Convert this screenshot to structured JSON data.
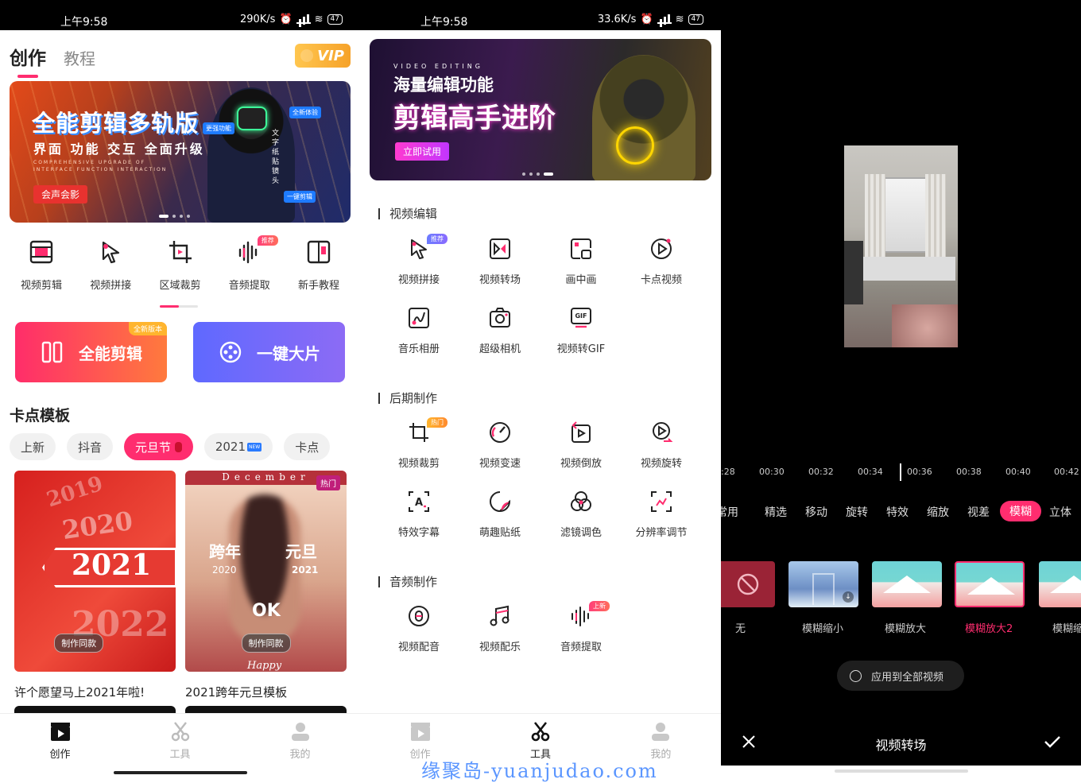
{
  "phone1": {
    "status": {
      "time": "上午9:58",
      "speed": "290K/s",
      "battery": "47"
    },
    "tabs": {
      "active": "创作",
      "other": "教程"
    },
    "vip": "VIP",
    "banner": {
      "headline": "全能剪辑多轨版",
      "sub": "界面 功能 交互 全面升级",
      "tiny": "COMPREHENSIVE UPGRADE OF INTERFACE FUNCTION INTERACTION",
      "button": "会声会影",
      "tag1": "全新体验",
      "tag2": "更强功能",
      "tag3": "一键剪辑",
      "side_text": "文字纸贴镜头"
    },
    "quick": [
      {
        "label": "视频剪辑",
        "icon": "film-icon"
      },
      {
        "label": "视频拼接",
        "icon": "play-cursor-icon"
      },
      {
        "label": "区域裁剪",
        "icon": "crop-icon"
      },
      {
        "label": "音频提取",
        "icon": "audio-wave-icon",
        "badge": "推荐"
      },
      {
        "label": "新手教程",
        "icon": "book-icon"
      }
    ],
    "big_buttons": [
      {
        "label": "全能剪辑",
        "badge": "全新版本"
      },
      {
        "label": "一键大片"
      }
    ],
    "section_title": "卡点模板",
    "chips": [
      "上新",
      "抖音",
      "元旦节",
      "2021",
      "卡点"
    ],
    "chip_new_tag": "NEW",
    "active_chip": "元旦节",
    "cards": [
      {
        "title": "许个愿望马上2021年啦!",
        "button": "制作同款",
        "years": [
          "2019",
          "2020",
          "2021",
          "2022"
        ]
      },
      {
        "title": "2021跨年元旦模板",
        "button": "制作同款",
        "hot": "热门",
        "header": "December",
        "left_big": "跨年",
        "left_year": "2020",
        "right_big": "元旦",
        "right_year": "2021",
        "ok": "OK",
        "footer": "Happy"
      }
    ],
    "tabbar": [
      {
        "label": "创作",
        "active": true
      },
      {
        "label": "工具",
        "active": false
      },
      {
        "label": "我的",
        "active": false
      }
    ]
  },
  "phone2": {
    "status": {
      "time": "上午9:58",
      "speed": "33.6K/s",
      "battery": "47"
    },
    "banner": {
      "ve": "VIDEO EDITING",
      "h1": "海量编辑功能",
      "h2": "剪辑高手进阶",
      "button": "立即试用"
    },
    "groups": [
      {
        "title": "视频编辑",
        "items": [
          {
            "label": "视频拼接",
            "icon": "play-cursor-icon",
            "badge": "推荐"
          },
          {
            "label": "视频转场",
            "icon": "transition-icon"
          },
          {
            "label": "画中画",
            "icon": "pip-icon"
          },
          {
            "label": "卡点视频",
            "icon": "beat-play-icon"
          },
          {
            "label": "音乐相册",
            "icon": "music-album-icon"
          },
          {
            "label": "超级相机",
            "icon": "camera-icon"
          },
          {
            "label": "视频转GIF",
            "icon": "gif-icon"
          }
        ]
      },
      {
        "title": "后期制作",
        "items": [
          {
            "label": "视频裁剪",
            "icon": "crop-icon",
            "badge": "热门"
          },
          {
            "label": "视频变速",
            "icon": "speed-icon"
          },
          {
            "label": "视频倒放",
            "icon": "reverse-icon"
          },
          {
            "label": "视频旋转",
            "icon": "rotate-icon"
          },
          {
            "label": "特效字幕",
            "icon": "subtitle-icon"
          },
          {
            "label": "萌趣贴纸",
            "icon": "sticker-icon"
          },
          {
            "label": "滤镜调色",
            "icon": "filter-icon"
          },
          {
            "label": "分辨率调节",
            "icon": "resolution-icon"
          }
        ]
      },
      {
        "title": "音频制作",
        "items": [
          {
            "label": "视频配音",
            "icon": "voiceover-icon"
          },
          {
            "label": "视频配乐",
            "icon": "music-note-icon"
          },
          {
            "label": "音频提取",
            "icon": "audio-wave-icon",
            "badge": "上新"
          }
        ]
      }
    ],
    "tabbar": [
      {
        "label": "创作",
        "active": false
      },
      {
        "label": "工具",
        "active": true
      },
      {
        "label": "我的",
        "active": false
      }
    ],
    "watermark": "缘聚岛-yuanjudao.com"
  },
  "phone3": {
    "timeline": ":28 · 00:30 · 00:32 · 00:34 · 00:36 · 00:38 · 00:40 · 00:42",
    "timeline_labels": [
      ":28",
      "00:30",
      "00:32",
      "00:34",
      "00:36",
      "00:38",
      "00:40",
      "00:42"
    ],
    "fx_tabs": [
      "常用",
      "精选",
      "移动",
      "旋转",
      "特效",
      "缩放",
      "视差",
      "模糊",
      "立体"
    ],
    "fx_active": "模糊",
    "thumbs": [
      {
        "label": "无"
      },
      {
        "label": "模糊缩小"
      },
      {
        "label": "模糊放大"
      },
      {
        "label": "模糊放大2",
        "selected": true
      },
      {
        "label": "模糊缩"
      }
    ],
    "apply_all": "应用到全部视频",
    "title": "视频转场"
  },
  "colors": {
    "accent": "#ff2d6f",
    "accent2": "#6a6bff",
    "dark": "#000000"
  }
}
